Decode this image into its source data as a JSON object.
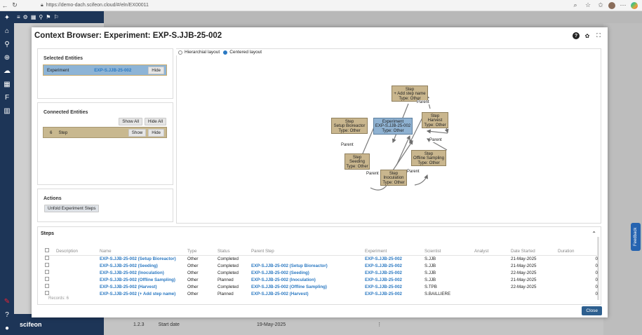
{
  "browser": {
    "url": "https://demo-dach.scifeon.cloud/#/eln/EX00011"
  },
  "app": {
    "logo": "scifeon",
    "bottom_row": {
      "number": "1.2.3",
      "label": "Start date",
      "value": "19-May-2025",
      "menu": "⋮"
    }
  },
  "feedback_label": "Feedback",
  "modal": {
    "title": "Context Browser: Experiment: EXP-S.JJB-25-002",
    "selected_entities": {
      "heading": "Selected Entities",
      "row": {
        "type": "Experiment",
        "id": "EXP-S.JJB-25-002",
        "action": "Hide"
      }
    },
    "connected_entities": {
      "heading": "Connected Entities",
      "show_all": "Show All",
      "hide_all": "Hide All",
      "row": {
        "count": "6",
        "type": "Step",
        "show": "Show",
        "hide": "Hide"
      }
    },
    "actions": {
      "heading": "Actions",
      "button": "Unfold Experiment Steps"
    },
    "layout": {
      "hierarchial": "Hierarchial layout",
      "centered": "Centered layout"
    },
    "graph": {
      "center": [
        "Experiment",
        "EXP-S.JJB-25-002",
        "Type: Other"
      ],
      "nodes": [
        [
          "Step",
          "+ Add step name",
          "Type: Other"
        ],
        [
          "Step",
          "Harvest",
          "Type: Other"
        ],
        [
          "Step",
          "Offline Sampling",
          "Type: Other"
        ],
        [
          "Step",
          "Inoculation",
          "Type: Other"
        ],
        [
          "Step",
          "Seeding",
          "Type: Other"
        ],
        [
          "Step",
          "Setup Bioreactor",
          "Type: Other"
        ]
      ],
      "edge_label": "Parent"
    },
    "steps": {
      "heading": "Steps",
      "columns": [
        "Description",
        "Name",
        "Type",
        "Status",
        "Parent Step",
        "Experiment",
        "Scientist",
        "Analyst",
        "Date Started",
        "Duration"
      ],
      "rows": [
        [
          "",
          "EXP-S.JJB-25-002 (Setup Bioreactor)",
          "Other",
          "Completed",
          "",
          "EXP-S.JJB-25-002",
          "S.JJB",
          "",
          "21-May-2025",
          "0"
        ],
        [
          "",
          "EXP-S.JJB-25-002 (Seeding)",
          "Other",
          "Completed",
          "EXP-S.JJB-25-002 (Setup Bioreactor)",
          "EXP-S.JJB-25-002",
          "S.JJB",
          "",
          "21-May-2025",
          "0"
        ],
        [
          "",
          "EXP-S.JJB-25-002 (Inoculation)",
          "Other",
          "Completed",
          "EXP-S.JJB-25-002 (Seeding)",
          "EXP-S.JJB-25-002",
          "S.JJB",
          "",
          "22-May-2025",
          "0"
        ],
        [
          "",
          "EXP-S.JJB-25-002 (Offline Sampling)",
          "Other",
          "Planned",
          "EXP-S.JJB-25-002 (Inoculation)",
          "EXP-S.JJB-25-002",
          "S.JJB",
          "",
          "21-May-2025",
          "0"
        ],
        [
          "",
          "EXP-S.JJB-25-002 (Harvest)",
          "Other",
          "Completed",
          "EXP-S.JJB-25-002 (Offline Sampling)",
          "EXP-S.JJB-25-002",
          "S.TPB",
          "",
          "22-May-2025",
          "0"
        ],
        [
          "",
          "EXP-S.JJB-25-002 (+ Add step name)",
          "Other",
          "Planned",
          "EXP-S.JJB-25-002 (Harvest)",
          "EXP-S.JJB-25-002",
          "S.BAILLIERE",
          "",
          "",
          "0"
        ]
      ],
      "records": "Records: 6"
    },
    "close": "Close"
  }
}
